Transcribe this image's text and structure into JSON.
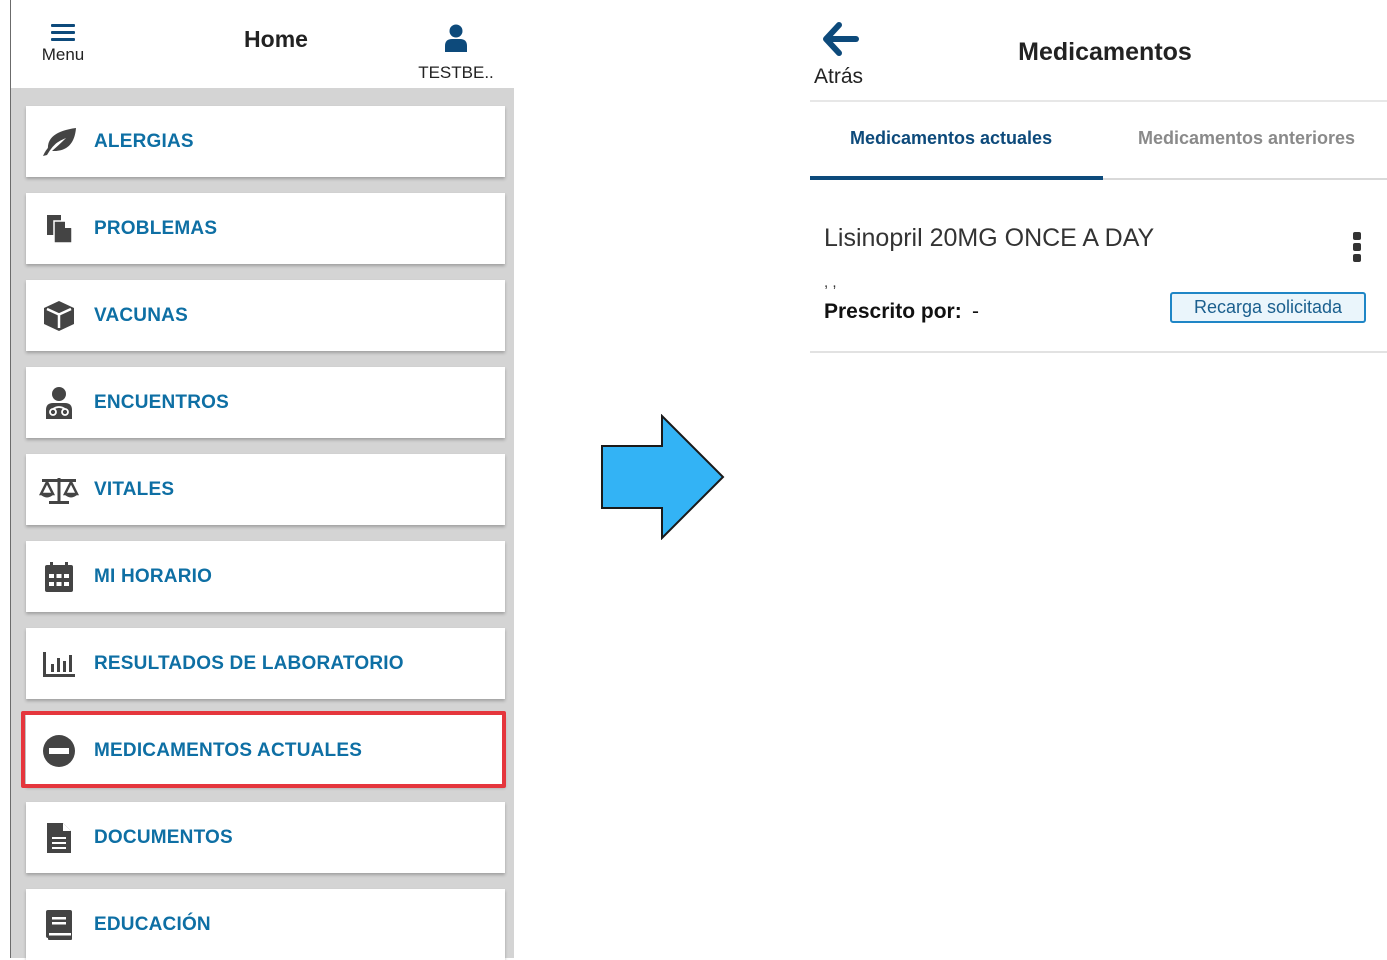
{
  "left_screen": {
    "header": {
      "menu_label": "Menu",
      "title": "Home",
      "user_label": "TESTBE..",
      "menu_icon": "hamburger-icon",
      "user_icon": "user-icon"
    },
    "menu_items": [
      {
        "label": "ALERGIAS",
        "icon": "leaf-icon"
      },
      {
        "label": "PROBLEMAS",
        "icon": "files-icon"
      },
      {
        "label": "VACUNAS",
        "icon": "cube-icon"
      },
      {
        "label": "ENCUENTROS",
        "icon": "doctor-icon"
      },
      {
        "label": "VITALES",
        "icon": "balance-scale-icon"
      },
      {
        "label": "MI HORARIO",
        "icon": "calendar-icon"
      },
      {
        "label": "RESULTADOS DE LABORATORIO",
        "icon": "bar-chart-icon"
      },
      {
        "label": "MEDICAMENTOS ACTUALES",
        "icon": "minus-circle-icon",
        "highlighted": true
      },
      {
        "label": "DOCUMENTOS",
        "icon": "document-icon"
      },
      {
        "label": "EDUCACIÓN",
        "icon": "book-icon"
      }
    ]
  },
  "transition_arrow": {
    "icon": "right-arrow-icon",
    "color": "#33b3f5"
  },
  "right_screen": {
    "header": {
      "back_label": "Atrás",
      "back_icon": "arrow-left-icon",
      "title": "Medicamentos"
    },
    "tabs": [
      {
        "label": "Medicamentos actuales",
        "active": true
      },
      {
        "label": "Medicamentos anteriores",
        "active": false
      }
    ],
    "medication": {
      "name": "Lisinopril 20MG ONCE A DAY",
      "dose_line": ", ,",
      "prescribed_by_label": "Prescrito por:",
      "prescribed_by_value": "-",
      "status_badge": "Recarga solicitada",
      "more_icon": "kebab-menu-icon"
    }
  },
  "colors": {
    "primary": "#0d4a7b",
    "link": "#0e6fa4",
    "highlight": "#e5363d",
    "badge_border": "#1f86c6"
  }
}
